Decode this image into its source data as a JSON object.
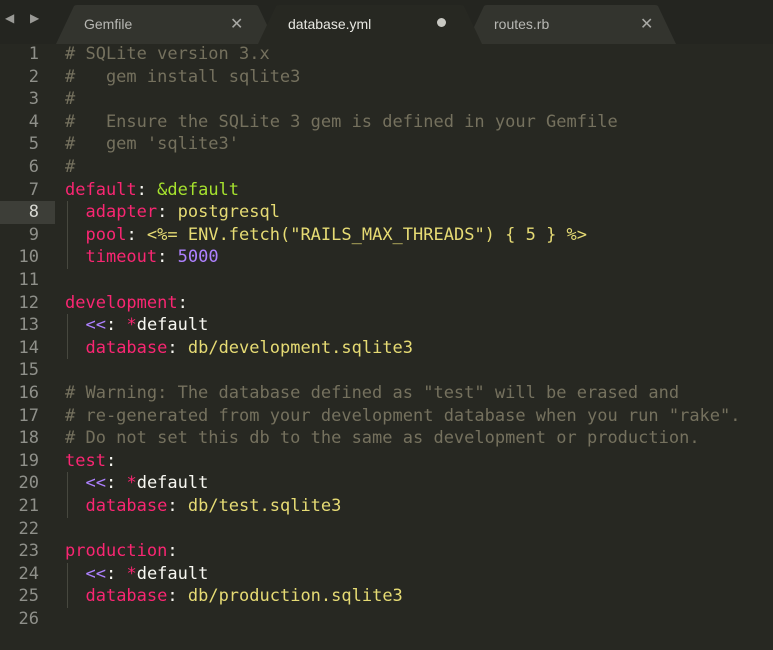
{
  "tabs": [
    {
      "label": "Gemfile",
      "close": "✕",
      "active": false
    },
    {
      "label": "database.yml",
      "active": true,
      "dirty": true
    },
    {
      "label": "routes.rb",
      "close": "✕",
      "active": false
    }
  ],
  "nav": {
    "left": "◀",
    "right": "▶"
  },
  "current_line": 8,
  "lines": [
    {
      "n": "1",
      "tokens": [
        {
          "t": "# SQLite version 3.x",
          "c": "comment"
        }
      ]
    },
    {
      "n": "2",
      "tokens": [
        {
          "t": "#   gem install sqlite3",
          "c": "comment"
        }
      ]
    },
    {
      "n": "3",
      "tokens": [
        {
          "t": "#",
          "c": "comment"
        }
      ]
    },
    {
      "n": "4",
      "tokens": [
        {
          "t": "#   Ensure the SQLite 3 gem is defined in your Gemfile",
          "c": "comment"
        }
      ]
    },
    {
      "n": "5",
      "tokens": [
        {
          "t": "#   gem 'sqlite3'",
          "c": "comment"
        }
      ]
    },
    {
      "n": "6",
      "tokens": [
        {
          "t": "#",
          "c": "comment"
        }
      ]
    },
    {
      "n": "7",
      "tokens": [
        {
          "t": "default",
          "c": "key"
        },
        {
          "t": ": ",
          "c": "plain"
        },
        {
          "t": "&default",
          "c": "anchor"
        }
      ]
    },
    {
      "n": "8",
      "tokens": [
        {
          "t": "  ",
          "c": "plain"
        },
        {
          "t": "adapter",
          "c": "key"
        },
        {
          "t": ": ",
          "c": "plain"
        },
        {
          "t": "postgresql",
          "c": "str"
        }
      ]
    },
    {
      "n": "9",
      "tokens": [
        {
          "t": "  ",
          "c": "plain"
        },
        {
          "t": "pool",
          "c": "key"
        },
        {
          "t": ": ",
          "c": "plain"
        },
        {
          "t": "<%= ENV.fetch(\"RAILS_MAX_THREADS\") { 5 } %>",
          "c": "str"
        }
      ]
    },
    {
      "n": "10",
      "tokens": [
        {
          "t": "  ",
          "c": "plain"
        },
        {
          "t": "timeout",
          "c": "key"
        },
        {
          "t": ": ",
          "c": "plain"
        },
        {
          "t": "5000",
          "c": "num"
        }
      ]
    },
    {
      "n": "11",
      "tokens": []
    },
    {
      "n": "12",
      "tokens": [
        {
          "t": "development",
          "c": "key"
        },
        {
          "t": ":",
          "c": "plain"
        }
      ]
    },
    {
      "n": "13",
      "tokens": [
        {
          "t": "  ",
          "c": "plain"
        },
        {
          "t": "<<",
          "c": "purple"
        },
        {
          "t": ": ",
          "c": "plain"
        },
        {
          "t": "*",
          "c": "key"
        },
        {
          "t": "default",
          "c": "plain"
        }
      ]
    },
    {
      "n": "14",
      "tokens": [
        {
          "t": "  ",
          "c": "plain"
        },
        {
          "t": "database",
          "c": "key"
        },
        {
          "t": ": ",
          "c": "plain"
        },
        {
          "t": "db/development.sqlite3",
          "c": "str"
        }
      ]
    },
    {
      "n": "15",
      "tokens": []
    },
    {
      "n": "16",
      "tokens": [
        {
          "t": "# Warning: The database defined as \"test\" will be erased and",
          "c": "comment"
        }
      ]
    },
    {
      "n": "17",
      "tokens": [
        {
          "t": "# re-generated from your development database when you run \"rake\".",
          "c": "comment"
        }
      ]
    },
    {
      "n": "18",
      "tokens": [
        {
          "t": "# Do not set this db to the same as development or production.",
          "c": "comment"
        }
      ]
    },
    {
      "n": "19",
      "tokens": [
        {
          "t": "test",
          "c": "key"
        },
        {
          "t": ":",
          "c": "plain"
        }
      ]
    },
    {
      "n": "20",
      "tokens": [
        {
          "t": "  ",
          "c": "plain"
        },
        {
          "t": "<<",
          "c": "purple"
        },
        {
          "t": ": ",
          "c": "plain"
        },
        {
          "t": "*",
          "c": "key"
        },
        {
          "t": "default",
          "c": "plain"
        }
      ]
    },
    {
      "n": "21",
      "tokens": [
        {
          "t": "  ",
          "c": "plain"
        },
        {
          "t": "database",
          "c": "key"
        },
        {
          "t": ": ",
          "c": "plain"
        },
        {
          "t": "db/test.sqlite3",
          "c": "str"
        }
      ]
    },
    {
      "n": "22",
      "tokens": []
    },
    {
      "n": "23",
      "tokens": [
        {
          "t": "production",
          "c": "key"
        },
        {
          "t": ":",
          "c": "plain"
        }
      ]
    },
    {
      "n": "24",
      "tokens": [
        {
          "t": "  ",
          "c": "plain"
        },
        {
          "t": "<<",
          "c": "purple"
        },
        {
          "t": ": ",
          "c": "plain"
        },
        {
          "t": "*",
          "c": "key"
        },
        {
          "t": "default",
          "c": "plain"
        }
      ]
    },
    {
      "n": "25",
      "tokens": [
        {
          "t": "  ",
          "c": "plain"
        },
        {
          "t": "database",
          "c": "key"
        },
        {
          "t": ": ",
          "c": "plain"
        },
        {
          "t": "db/production.sqlite3",
          "c": "str"
        }
      ]
    },
    {
      "n": "26",
      "tokens": []
    }
  ]
}
